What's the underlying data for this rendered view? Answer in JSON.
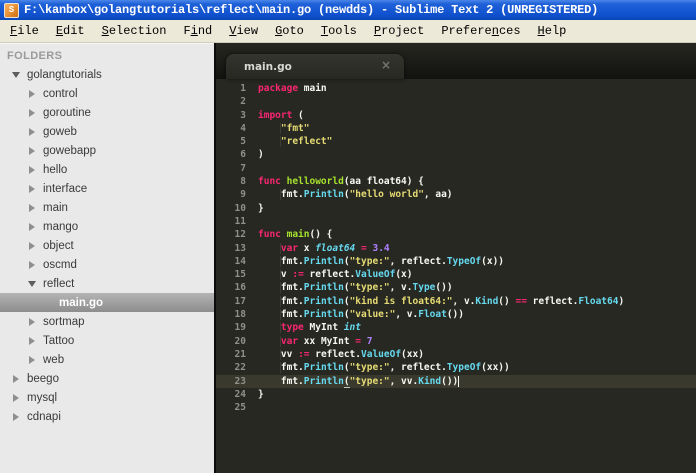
{
  "window": {
    "title": "F:\\kanbox\\golangtutorials\\reflect\\main.go (newdds) - Sublime Text 2 (UNREGISTERED)",
    "icon_letter": "S"
  },
  "menu": {
    "items": [
      {
        "pre": "",
        "u": "F",
        "post": "ile"
      },
      {
        "pre": "",
        "u": "E",
        "post": "dit"
      },
      {
        "pre": "",
        "u": "S",
        "post": "election"
      },
      {
        "pre": "F",
        "u": "i",
        "post": "nd"
      },
      {
        "pre": "",
        "u": "V",
        "post": "iew"
      },
      {
        "pre": "",
        "u": "G",
        "post": "oto"
      },
      {
        "pre": "",
        "u": "T",
        "post": "ools"
      },
      {
        "pre": "",
        "u": "P",
        "post": "roject"
      },
      {
        "pre": "Prefere",
        "u": "n",
        "post": "ces"
      },
      {
        "pre": "",
        "u": "H",
        "post": "elp"
      }
    ]
  },
  "sidebar": {
    "header": "FOLDERS",
    "items": [
      {
        "label": "golangtutorials",
        "level": 0,
        "state": "expanded",
        "selected": false
      },
      {
        "label": "control",
        "level": 1,
        "state": "collapsed",
        "selected": false
      },
      {
        "label": "goroutine",
        "level": 1,
        "state": "collapsed",
        "selected": false
      },
      {
        "label": "goweb",
        "level": 1,
        "state": "collapsed",
        "selected": false
      },
      {
        "label": "gowebapp",
        "level": 1,
        "state": "collapsed",
        "selected": false
      },
      {
        "label": "hello",
        "level": 1,
        "state": "collapsed",
        "selected": false
      },
      {
        "label": "interface",
        "level": 1,
        "state": "collapsed",
        "selected": false
      },
      {
        "label": "main",
        "level": 1,
        "state": "collapsed",
        "selected": false
      },
      {
        "label": "mango",
        "level": 1,
        "state": "collapsed",
        "selected": false
      },
      {
        "label": "object",
        "level": 1,
        "state": "collapsed",
        "selected": false
      },
      {
        "label": "oscmd",
        "level": 1,
        "state": "collapsed",
        "selected": false
      },
      {
        "label": "reflect",
        "level": 1,
        "state": "expanded",
        "selected": false
      },
      {
        "label": "main.go",
        "level": 2,
        "state": "file",
        "selected": true
      },
      {
        "label": "sortmap",
        "level": 1,
        "state": "collapsed",
        "selected": false
      },
      {
        "label": "Tattoo",
        "level": 1,
        "state": "collapsed",
        "selected": false
      },
      {
        "label": "web",
        "level": 1,
        "state": "collapsed",
        "selected": false
      },
      {
        "label": "beego",
        "level": 0,
        "state": "collapsed",
        "selected": false
      },
      {
        "label": "mysql",
        "level": 0,
        "state": "collapsed",
        "selected": false
      },
      {
        "label": "cdnapi",
        "level": 0,
        "state": "collapsed",
        "selected": false
      }
    ]
  },
  "tab": {
    "label": "main.go",
    "close_glyph": "×"
  },
  "editor": {
    "language": "go",
    "lines": [
      {
        "num": 1,
        "tokens": [
          [
            "k",
            "package"
          ],
          [
            "p",
            " main"
          ]
        ]
      },
      {
        "num": 2,
        "tokens": []
      },
      {
        "num": 3,
        "tokens": [
          [
            "k",
            "import"
          ],
          [
            "p",
            " ("
          ]
        ]
      },
      {
        "num": 4,
        "tokens": [
          [
            "g",
            "    "
          ],
          [
            "s",
            "\"fmt\""
          ]
        ]
      },
      {
        "num": 5,
        "tokens": [
          [
            "g",
            "    "
          ],
          [
            "s",
            "\"reflect\""
          ]
        ]
      },
      {
        "num": 6,
        "tokens": [
          [
            "p",
            ")"
          ]
        ]
      },
      {
        "num": 7,
        "tokens": []
      },
      {
        "num": 8,
        "tokens": [
          [
            "k",
            "func "
          ],
          [
            "f",
            "helloworld"
          ],
          [
            "p",
            "(aa float64) {"
          ]
        ]
      },
      {
        "num": 9,
        "tokens": [
          [
            "g",
            "    "
          ],
          [
            "p",
            "fmt."
          ],
          [
            "m",
            "Println"
          ],
          [
            "p",
            "("
          ],
          [
            "s",
            "\"hello world\""
          ],
          [
            "p",
            ", aa)"
          ]
        ]
      },
      {
        "num": 10,
        "tokens": [
          [
            "p",
            "}"
          ]
        ]
      },
      {
        "num": 11,
        "tokens": []
      },
      {
        "num": 12,
        "tokens": [
          [
            "k",
            "func "
          ],
          [
            "f",
            "main"
          ],
          [
            "p",
            "() {"
          ]
        ]
      },
      {
        "num": 13,
        "tokens": [
          [
            "g",
            "    "
          ],
          [
            "k",
            "var"
          ],
          [
            "p",
            " x "
          ],
          [
            "t",
            "float64"
          ],
          [
            "p",
            " "
          ],
          [
            "k",
            "="
          ],
          [
            "p",
            " "
          ],
          [
            "n",
            "3.4"
          ]
        ]
      },
      {
        "num": 14,
        "tokens": [
          [
            "g",
            "    "
          ],
          [
            "p",
            "fmt."
          ],
          [
            "m",
            "Println"
          ],
          [
            "p",
            "("
          ],
          [
            "s",
            "\"type:\""
          ],
          [
            "p",
            ", reflect."
          ],
          [
            "m",
            "TypeOf"
          ],
          [
            "p",
            "(x))"
          ]
        ]
      },
      {
        "num": 15,
        "tokens": [
          [
            "g",
            "    "
          ],
          [
            "p",
            "v "
          ],
          [
            "k",
            ":="
          ],
          [
            "p",
            " reflect."
          ],
          [
            "m",
            "ValueOf"
          ],
          [
            "p",
            "(x)"
          ]
        ]
      },
      {
        "num": 16,
        "tokens": [
          [
            "g",
            "    "
          ],
          [
            "p",
            "fmt."
          ],
          [
            "m",
            "Println"
          ],
          [
            "p",
            "("
          ],
          [
            "s",
            "\"type:\""
          ],
          [
            "p",
            ", v."
          ],
          [
            "m",
            "Type"
          ],
          [
            "p",
            "())"
          ]
        ]
      },
      {
        "num": 17,
        "tokens": [
          [
            "g",
            "    "
          ],
          [
            "p",
            "fmt."
          ],
          [
            "m",
            "Println"
          ],
          [
            "p",
            "("
          ],
          [
            "s",
            "\"kind is float64:\""
          ],
          [
            "p",
            ", v."
          ],
          [
            "m",
            "Kind"
          ],
          [
            "p",
            "() "
          ],
          [
            "k",
            "=="
          ],
          [
            "p",
            " reflect."
          ],
          [
            "m",
            "Float64"
          ],
          [
            "p",
            ")"
          ]
        ]
      },
      {
        "num": 18,
        "tokens": [
          [
            "g",
            "    "
          ],
          [
            "p",
            "fmt."
          ],
          [
            "m",
            "Println"
          ],
          [
            "p",
            "("
          ],
          [
            "s",
            "\"value:\""
          ],
          [
            "p",
            ", v."
          ],
          [
            "m",
            "Float"
          ],
          [
            "p",
            "())"
          ]
        ]
      },
      {
        "num": 19,
        "tokens": [
          [
            "g",
            "    "
          ],
          [
            "k",
            "type"
          ],
          [
            "p",
            " MyInt "
          ],
          [
            "t",
            "int"
          ]
        ]
      },
      {
        "num": 20,
        "tokens": [
          [
            "g",
            "    "
          ],
          [
            "k",
            "var"
          ],
          [
            "p",
            " xx MyInt "
          ],
          [
            "k",
            "="
          ],
          [
            "p",
            " "
          ],
          [
            "n",
            "7"
          ]
        ]
      },
      {
        "num": 21,
        "tokens": [
          [
            "g",
            "    "
          ],
          [
            "p",
            "vv "
          ],
          [
            "k",
            ":="
          ],
          [
            "p",
            " reflect."
          ],
          [
            "m",
            "ValueOf"
          ],
          [
            "p",
            "(xx)"
          ]
        ]
      },
      {
        "num": 22,
        "tokens": [
          [
            "g",
            "    "
          ],
          [
            "p",
            "fmt."
          ],
          [
            "m",
            "Println"
          ],
          [
            "p",
            "("
          ],
          [
            "s",
            "\"type:\""
          ],
          [
            "p",
            ", reflect."
          ],
          [
            "m",
            "TypeOf"
          ],
          [
            "p",
            "(xx))"
          ]
        ]
      },
      {
        "num": 23,
        "tokens": [
          [
            "g",
            "    "
          ],
          [
            "p",
            "fmt."
          ],
          [
            "m",
            "Println"
          ],
          [
            "u",
            "("
          ],
          [
            "s",
            "\"type:\""
          ],
          [
            "p",
            ", vv."
          ],
          [
            "m",
            "Kind"
          ],
          [
            "p",
            "())"
          ]
        ],
        "active": true,
        "caret": true
      },
      {
        "num": 24,
        "tokens": [
          [
            "p",
            "}"
          ]
        ]
      },
      {
        "num": 25,
        "tokens": []
      }
    ]
  },
  "colors": {
    "titlebar_blue": "#1152cf",
    "menubar_bg": "#ece9d8",
    "sidebar_bg": "#e9e9e9",
    "sidebar_selection": "#9a9a9a",
    "editor_bg": "#272822",
    "active_line_bg": "#3a392e",
    "line_number": "#90908a",
    "keyword": "#f92672",
    "string": "#e6db74",
    "number": "#ae81ff",
    "type_italic": "#66d9ef",
    "method": "#66d9ef",
    "function_name": "#a6e22e",
    "plain_text": "#f8f8f2"
  }
}
